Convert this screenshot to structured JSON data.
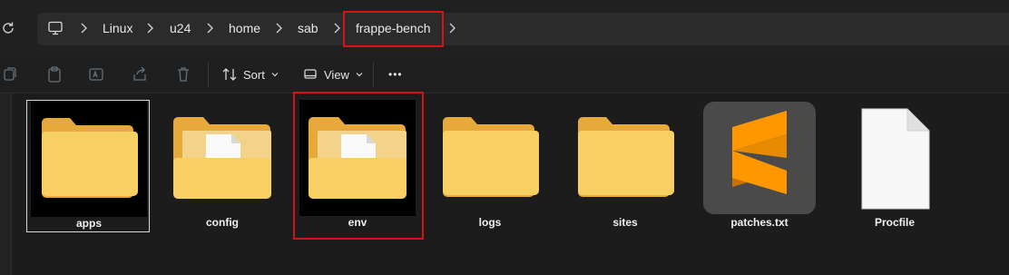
{
  "breadcrumb": {
    "items": [
      {
        "label": "Linux"
      },
      {
        "label": "u24"
      },
      {
        "label": "home"
      },
      {
        "label": "sab"
      },
      {
        "label": "frappe-bench"
      }
    ]
  },
  "toolbar": {
    "sort_label": "Sort",
    "view_label": "View",
    "more_label": "•••"
  },
  "items": [
    {
      "name": "apps",
      "type": "folder"
    },
    {
      "name": "config",
      "type": "folder-with-file"
    },
    {
      "name": "env",
      "type": "folder-with-file"
    },
    {
      "name": "logs",
      "type": "folder"
    },
    {
      "name": "sites",
      "type": "folder"
    },
    {
      "name": "patches.txt",
      "type": "sublime-text-file"
    },
    {
      "name": "Procfile",
      "type": "blank-file"
    }
  ],
  "colors": {
    "highlight": "#d21414",
    "folder_back": "#e6a93a",
    "folder_front": "#f7cf62",
    "sublime_orange": "#ff9800"
  }
}
